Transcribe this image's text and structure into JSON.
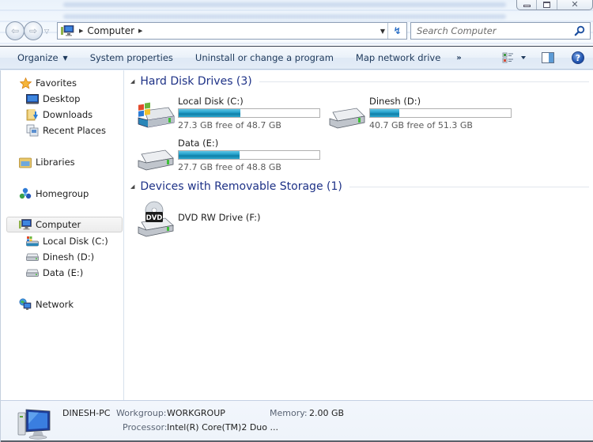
{
  "window": {
    "controls": {
      "minimize": "minimize",
      "maximize": "maximize",
      "close": "close"
    }
  },
  "address_bar": {
    "location_icon": "computer-icon",
    "path": [
      "Computer"
    ],
    "refresh_icon": "refresh-icon"
  },
  "search": {
    "placeholder": "Search Computer",
    "value": ""
  },
  "toolbar": {
    "organize_label": "Organize",
    "system_properties_label": "System properties",
    "uninstall_label": "Uninstall or change a program",
    "map_drive_label": "Map network drive",
    "more_label": "»"
  },
  "sidebar": {
    "favorites": {
      "label": "Favorites",
      "items": [
        {
          "label": "Desktop",
          "icon": "desktop-icon"
        },
        {
          "label": "Downloads",
          "icon": "downloads-folder-icon"
        },
        {
          "label": "Recent Places",
          "icon": "recent-places-icon"
        }
      ]
    },
    "libraries": {
      "label": "Libraries"
    },
    "homegroup": {
      "label": "Homegroup"
    },
    "computer": {
      "label": "Computer",
      "selected": true,
      "items": [
        {
          "label": "Local Disk (C:)"
        },
        {
          "label": "Dinesh (D:)"
        },
        {
          "label": "Data (E:)"
        }
      ]
    },
    "network": {
      "label": "Network"
    }
  },
  "main": {
    "hard_disk_group": {
      "title": "Hard Disk Drives (3)",
      "drives": [
        {
          "name": "Local Disk (C:)",
          "free_text": "27.3 GB free of 48.7 GB",
          "used_fraction": 0.44,
          "icon": "windows-drive-icon"
        },
        {
          "name": "Dinesh (D:)",
          "free_text": "40.7 GB free of 51.3 GB",
          "used_fraction": 0.21,
          "icon": "hard-drive-icon"
        },
        {
          "name": "Data (E:)",
          "free_text": "27.7 GB free of 48.8 GB",
          "used_fraction": 0.43,
          "icon": "hard-drive-icon"
        }
      ]
    },
    "removable_group": {
      "title": "Devices with Removable Storage (1)",
      "devices": [
        {
          "name": "DVD RW Drive (F:)",
          "icon": "dvd-drive-icon",
          "badge": "DVD"
        }
      ]
    }
  },
  "details": {
    "computer_name": "DINESH-PC",
    "workgroup_label": "Workgroup:",
    "workgroup_value": "WORKGROUP",
    "memory_label": "Memory:",
    "memory_value": "2.00 GB",
    "processor_label": "Processor:",
    "processor_value": "Intel(R) Core(TM)2 Duo ..."
  },
  "colors": {
    "group_title": "#1e3287",
    "toolbar_text": "#1e395b",
    "bar_fill": "#27a3cd"
  }
}
